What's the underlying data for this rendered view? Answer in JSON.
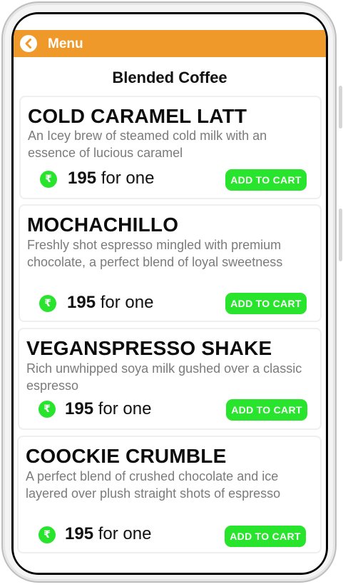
{
  "header": {
    "title": "Menu",
    "back_icon": "chevron-left-icon",
    "color": "#f0992b"
  },
  "page_title": "Blended Coffee",
  "accent_color": "#28e42c",
  "items": [
    {
      "name": "COLD CARAMEL LATT",
      "description": "An Icey brew of steamed cold milk with an essence of lucious caramel",
      "currency_symbol": "₹",
      "price": "195",
      "price_suffix": " for one",
      "button_label": "ADD TO CART"
    },
    {
      "name": "MOCHACHILLO",
      "description": "Freshly shot espresso mingled with premium chocolate, a perfect blend of loyal sweetness",
      "currency_symbol": "₹",
      "price": "195",
      "price_suffix": " for one",
      "button_label": "ADD TO CART"
    },
    {
      "name": "VEGANSPRESSO SHAKE",
      "description": "Rich unwhipped soya milk gushed over a classic espresso",
      "currency_symbol": "₹",
      "price": "195",
      "price_suffix": " for one",
      "button_label": "ADD TO CART"
    },
    {
      "name": "COOCKIE CRUMBLE",
      "description": "A perfect blend of crushed chocolate and ice layered over plush straight shots of espresso",
      "currency_symbol": "₹",
      "price": "195",
      "price_suffix": " for one",
      "button_label": "ADD TO CART"
    }
  ]
}
